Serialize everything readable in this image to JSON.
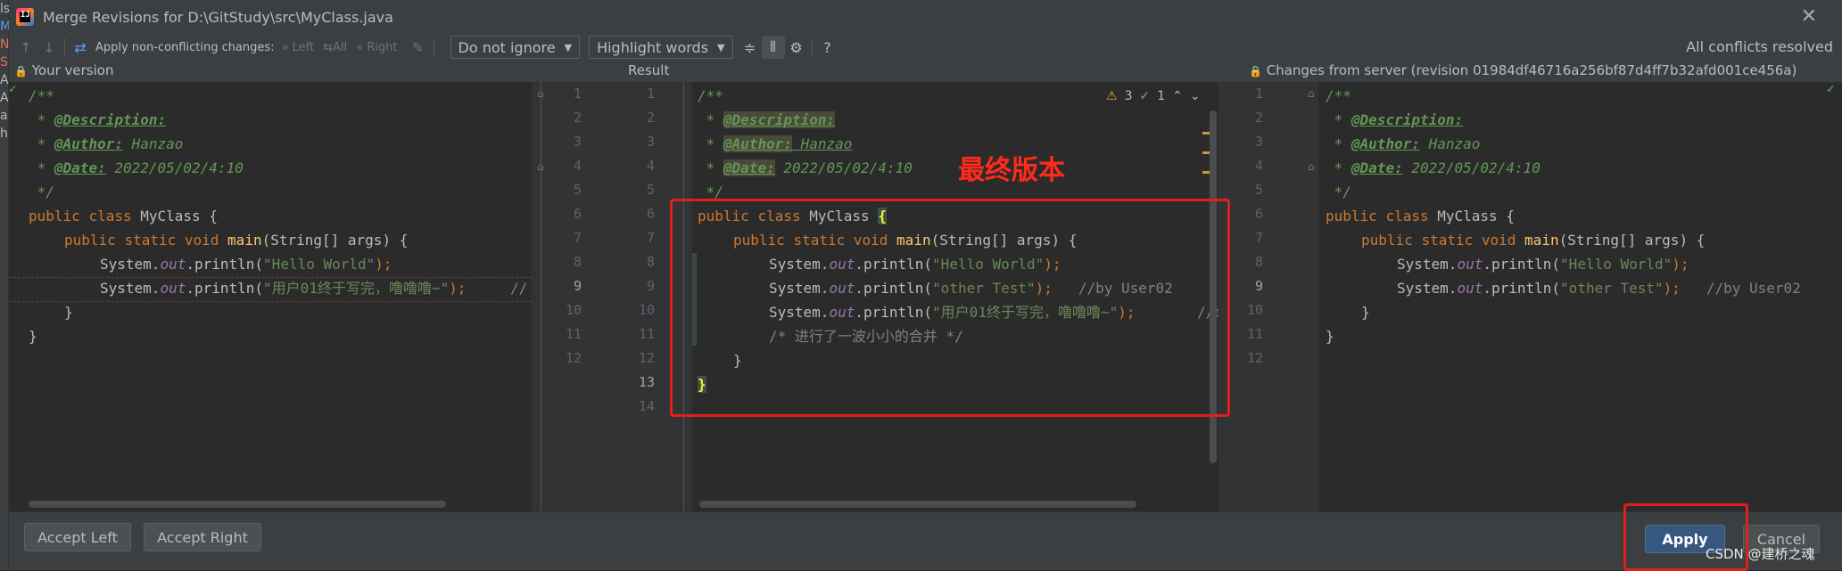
{
  "ide_strip": [
    "ls",
    "M",
    "N",
    "S",
    "A",
    "A",
    "a",
    "h"
  ],
  "window": {
    "title": "Merge Revisions for D:\\GitStudy\\src\\MyClass.java"
  },
  "toolbar": {
    "apply_non_conflicting": "Apply non-conflicting changes:",
    "left": "Left",
    "all": "All",
    "right": "Right",
    "ignore_dropdown": "Do not ignore",
    "highlight_dropdown": "Highlight words",
    "status": "All conflicts resolved"
  },
  "headers": {
    "left": "Your version",
    "middle": "Result",
    "right": "Changes from server (revision 01984df46716a256bf87d4ff7b32afd001ce456a)"
  },
  "result_badges": {
    "warnings": "3",
    "ok": "1"
  },
  "code": {
    "comment_open": "/**",
    "desc_prefix": " * ",
    "desc_tag": "@Description:",
    "author_tag": "@Author:",
    "author_val": " Hanzao",
    "date_tag": "@Date:",
    "date_val": " 2022/05/02/4:10",
    "comment_close": " */",
    "public": "public",
    "class": "class",
    "class_name": " MyClass ",
    "brace_open": "{",
    "static": "static",
    "void": "void",
    "main": "main",
    "main_args": "(String[] args) {",
    "system": "System.",
    "out": "out",
    "println": ".println(",
    "hello": "\"Hello World\"",
    "other": "\"other Test\"",
    "user01_left": "\"用户01终于写完，噜噜噜~\"",
    "user01_mid": "\"用户01终于写完，噜噜噜~\"",
    "close_stmt": ");",
    "by_user02": "//by User02",
    "by_trunc": "//by U",
    "left_trunc_comment": "//",
    "merge_comment": "/* 进行了一波小小的合并 */",
    "inner_close": "}",
    "outer_close": "}"
  },
  "line_numbers_middle_left": [
    "1",
    "2",
    "3",
    "4",
    "5",
    "6",
    "7",
    "8",
    "9",
    "10",
    "11",
    "12"
  ],
  "line_numbers_middle_right": [
    "1",
    "2",
    "3",
    "4",
    "5",
    "6",
    "7",
    "8",
    "9",
    "10",
    "11",
    "12",
    "13",
    "14"
  ],
  "line_numbers_right": [
    "1",
    "2",
    "3",
    "4",
    "5",
    "6",
    "7",
    "8",
    "9",
    "10",
    "11",
    "12"
  ],
  "annotation": "最终版本",
  "buttons": {
    "accept_left": "Accept Left",
    "accept_right": "Accept Right",
    "apply": "Apply",
    "cancel": "Cancel"
  },
  "watermark": "CSDN @建桥之魂",
  "colors": {
    "keyword": "#cc7832",
    "string": "#6a8759",
    "comment": "#629755",
    "highlight_box": "#e0201a",
    "apply_button": "#365880"
  }
}
